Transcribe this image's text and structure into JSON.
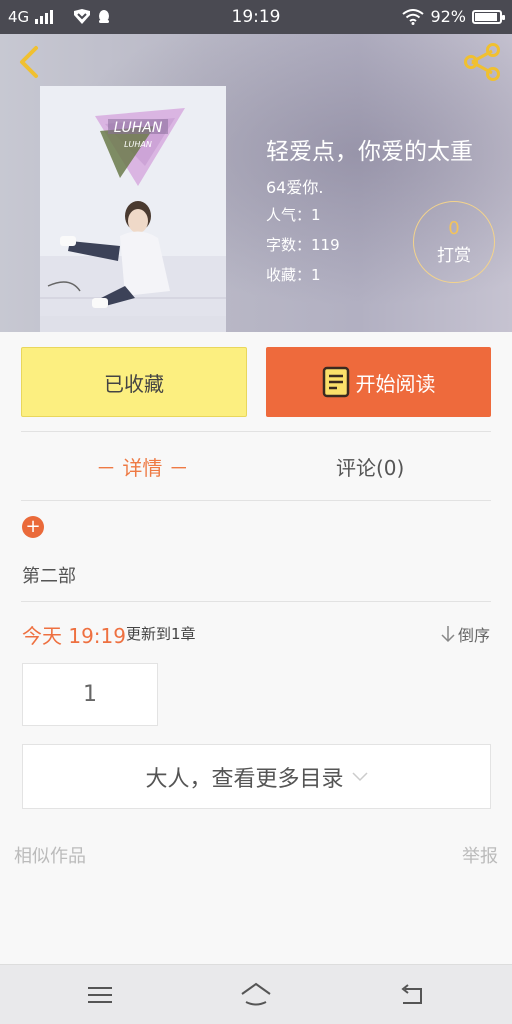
{
  "status_bar": {
    "network": "4G",
    "time": "19:19",
    "battery_percent": "92%",
    "battery_level": 0.92,
    "icons": [
      "signal-icon",
      "vpn-shield-icon",
      "qq-notification-icon",
      "wifi-icon",
      "battery-icon"
    ]
  },
  "header": {
    "icons": [
      "back-arrow-icon",
      "share-icon"
    ],
    "accent_color": "#f0c030"
  },
  "book": {
    "cover_text_1": "LUHAN",
    "cover_text_2": "LUHAN",
    "title": "轻爱点，你爱的太重",
    "author": "64爱你.",
    "popularity": "人气：1",
    "word_count": "字数：119",
    "favorites": "收藏：1",
    "tip": {
      "count": "0",
      "label": "打赏"
    }
  },
  "actions": {
    "favorited_label": "已收藏",
    "read_label": "开始阅读",
    "colors": {
      "favorited_bg": "#fcef80",
      "read_bg": "#ee6a3c"
    }
  },
  "tabs": [
    {
      "label": "－ 详情 －",
      "active": true
    },
    {
      "label": "评论(0)",
      "active": false
    }
  ],
  "catalog": {
    "add_symbol": "+",
    "volume": "第二部",
    "update_date": "今天 19:19",
    "update_note": "更新到1章",
    "sort_label": "倒序",
    "chapters": [
      "1"
    ],
    "more_label": "大人，查看更多目录"
  },
  "footer": {
    "similar_label": "相似作品",
    "report_label": "举报"
  },
  "nav_bar": {
    "icons": [
      "menu-icon",
      "home-icon",
      "return-icon"
    ]
  }
}
